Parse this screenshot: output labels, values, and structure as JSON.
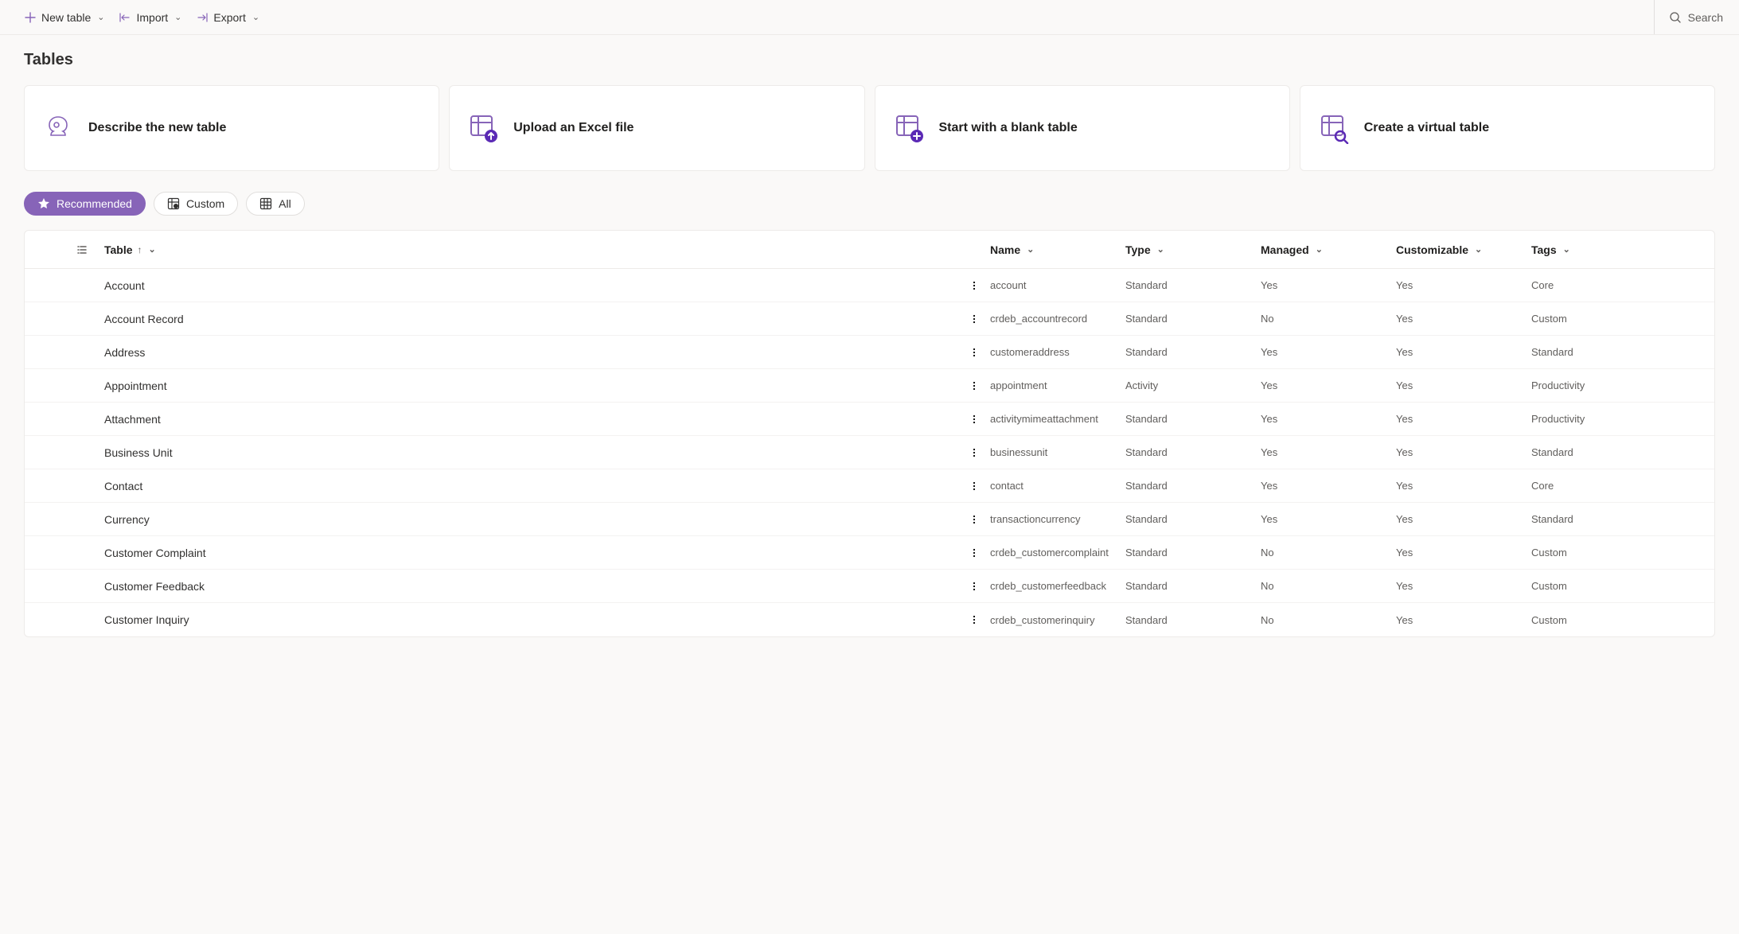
{
  "toolbar": {
    "newTable": "New table",
    "import": "Import",
    "export": "Export",
    "search": "Search"
  },
  "pageTitle": "Tables",
  "cards": [
    {
      "id": "describe",
      "label": "Describe the new table"
    },
    {
      "id": "upload",
      "label": "Upload an Excel file"
    },
    {
      "id": "blank",
      "label": "Start with a blank table"
    },
    {
      "id": "virtual",
      "label": "Create a virtual table"
    }
  ],
  "filters": {
    "recommended": "Recommended",
    "custom": "Custom",
    "all": "All"
  },
  "columns": {
    "table": "Table",
    "name": "Name",
    "type": "Type",
    "managed": "Managed",
    "customizable": "Customizable",
    "tags": "Tags"
  },
  "rows": [
    {
      "table": "Account",
      "name": "account",
      "type": "Standard",
      "managed": "Yes",
      "customizable": "Yes",
      "tags": "Core"
    },
    {
      "table": "Account Record",
      "name": "crdeb_accountrecord",
      "type": "Standard",
      "managed": "No",
      "customizable": "Yes",
      "tags": "Custom"
    },
    {
      "table": "Address",
      "name": "customeraddress",
      "type": "Standard",
      "managed": "Yes",
      "customizable": "Yes",
      "tags": "Standard"
    },
    {
      "table": "Appointment",
      "name": "appointment",
      "type": "Activity",
      "managed": "Yes",
      "customizable": "Yes",
      "tags": "Productivity"
    },
    {
      "table": "Attachment",
      "name": "activitymimeattachment",
      "type": "Standard",
      "managed": "Yes",
      "customizable": "Yes",
      "tags": "Productivity"
    },
    {
      "table": "Business Unit",
      "name": "businessunit",
      "type": "Standard",
      "managed": "Yes",
      "customizable": "Yes",
      "tags": "Standard"
    },
    {
      "table": "Contact",
      "name": "contact",
      "type": "Standard",
      "managed": "Yes",
      "customizable": "Yes",
      "tags": "Core"
    },
    {
      "table": "Currency",
      "name": "transactioncurrency",
      "type": "Standard",
      "managed": "Yes",
      "customizable": "Yes",
      "tags": "Standard"
    },
    {
      "table": "Customer Complaint",
      "name": "crdeb_customercomplaint",
      "type": "Standard",
      "managed": "No",
      "customizable": "Yes",
      "tags": "Custom"
    },
    {
      "table": "Customer Feedback",
      "name": "crdeb_customerfeedback",
      "type": "Standard",
      "managed": "No",
      "customizable": "Yes",
      "tags": "Custom"
    },
    {
      "table": "Customer Inquiry",
      "name": "crdeb_customerinquiry",
      "type": "Standard",
      "managed": "No",
      "customizable": "Yes",
      "tags": "Custom"
    }
  ]
}
